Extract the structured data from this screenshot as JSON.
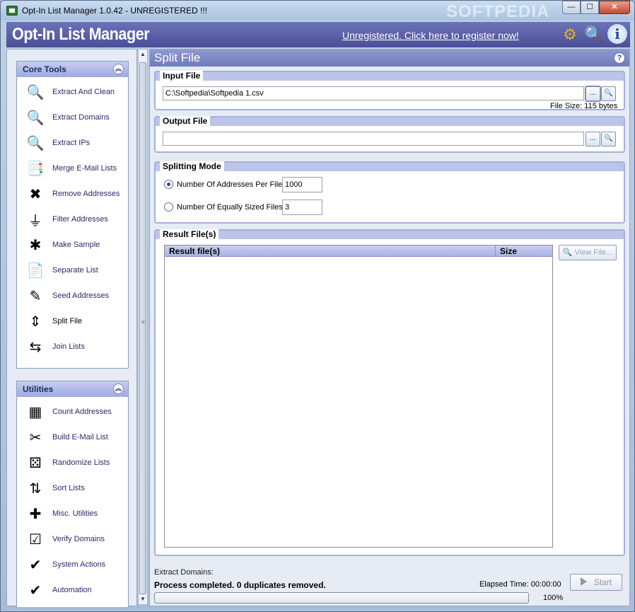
{
  "window": {
    "title": "Opt-In List Manager 1.0.42 - UNREGISTERED !!!",
    "watermark": "SOFTPEDIA",
    "minimize": "—",
    "maximize": "☐",
    "close": "✕"
  },
  "banner": {
    "title": "Opt-In List Manager",
    "register_link": "Unregistered. Click here to register now!"
  },
  "sidebar": {
    "core_tools": {
      "title": "Core Tools",
      "items": [
        {
          "label": "Extract And Clean",
          "icon": "🔍"
        },
        {
          "label": "Extract Domains",
          "icon": "🔍"
        },
        {
          "label": "Extract IPs",
          "icon": "🔍"
        },
        {
          "label": "Merge E-Mail Lists",
          "icon": "📑"
        },
        {
          "label": "Remove Addresses",
          "icon": "✖"
        },
        {
          "label": "Filter Addresses",
          "icon": "⏚"
        },
        {
          "label": "Make Sample",
          "icon": "✱"
        },
        {
          "label": "Separate List",
          "icon": "📄"
        },
        {
          "label": "Seed Addresses",
          "icon": "✎"
        },
        {
          "label": "Split File",
          "icon": "⇕"
        },
        {
          "label": "Join Lists",
          "icon": "⇆"
        }
      ]
    },
    "utilities": {
      "title": "Utilities",
      "items": [
        {
          "label": "Count Addresses",
          "icon": "▦"
        },
        {
          "label": "Build E-Mail List",
          "icon": "✂"
        },
        {
          "label": "Randomize Lists",
          "icon": "⚄"
        },
        {
          "label": "Sort Lists",
          "icon": "⇅"
        },
        {
          "label": "Misc. Utilities",
          "icon": "✚"
        },
        {
          "label": "Verify Domains",
          "icon": "☑"
        },
        {
          "label": "System Actions",
          "icon": "✔"
        },
        {
          "label": "Automation",
          "icon": "✔"
        }
      ]
    }
  },
  "main": {
    "title": "Split File",
    "help": "?",
    "input_file": {
      "label": "Input File",
      "value": "C:\\Softpedia\\Softpedia 1.csv",
      "browse": "...",
      "file_size": "File Size: 115 bytes"
    },
    "output_file": {
      "label": "Output File",
      "value": "",
      "browse": "..."
    },
    "splitting_mode": {
      "label": "Splitting Mode",
      "option1": {
        "label": "Number Of Addresses Per File",
        "value": "1000",
        "selected": true
      },
      "option2": {
        "label": "Number Of Equally Sized Files",
        "value": "3",
        "selected": false
      }
    },
    "result_files": {
      "label": "Result File(s)",
      "columns": [
        "Result file(s)",
        "Size"
      ],
      "view_button": "View File..."
    },
    "status": {
      "task": "Extract Domains:",
      "message": "Process completed. 0 duplicates removed.",
      "elapsed": "Elapsed Time:  00:00:00",
      "progress_pct": "100%",
      "progress_value": 100,
      "start_button": "Start"
    }
  }
}
